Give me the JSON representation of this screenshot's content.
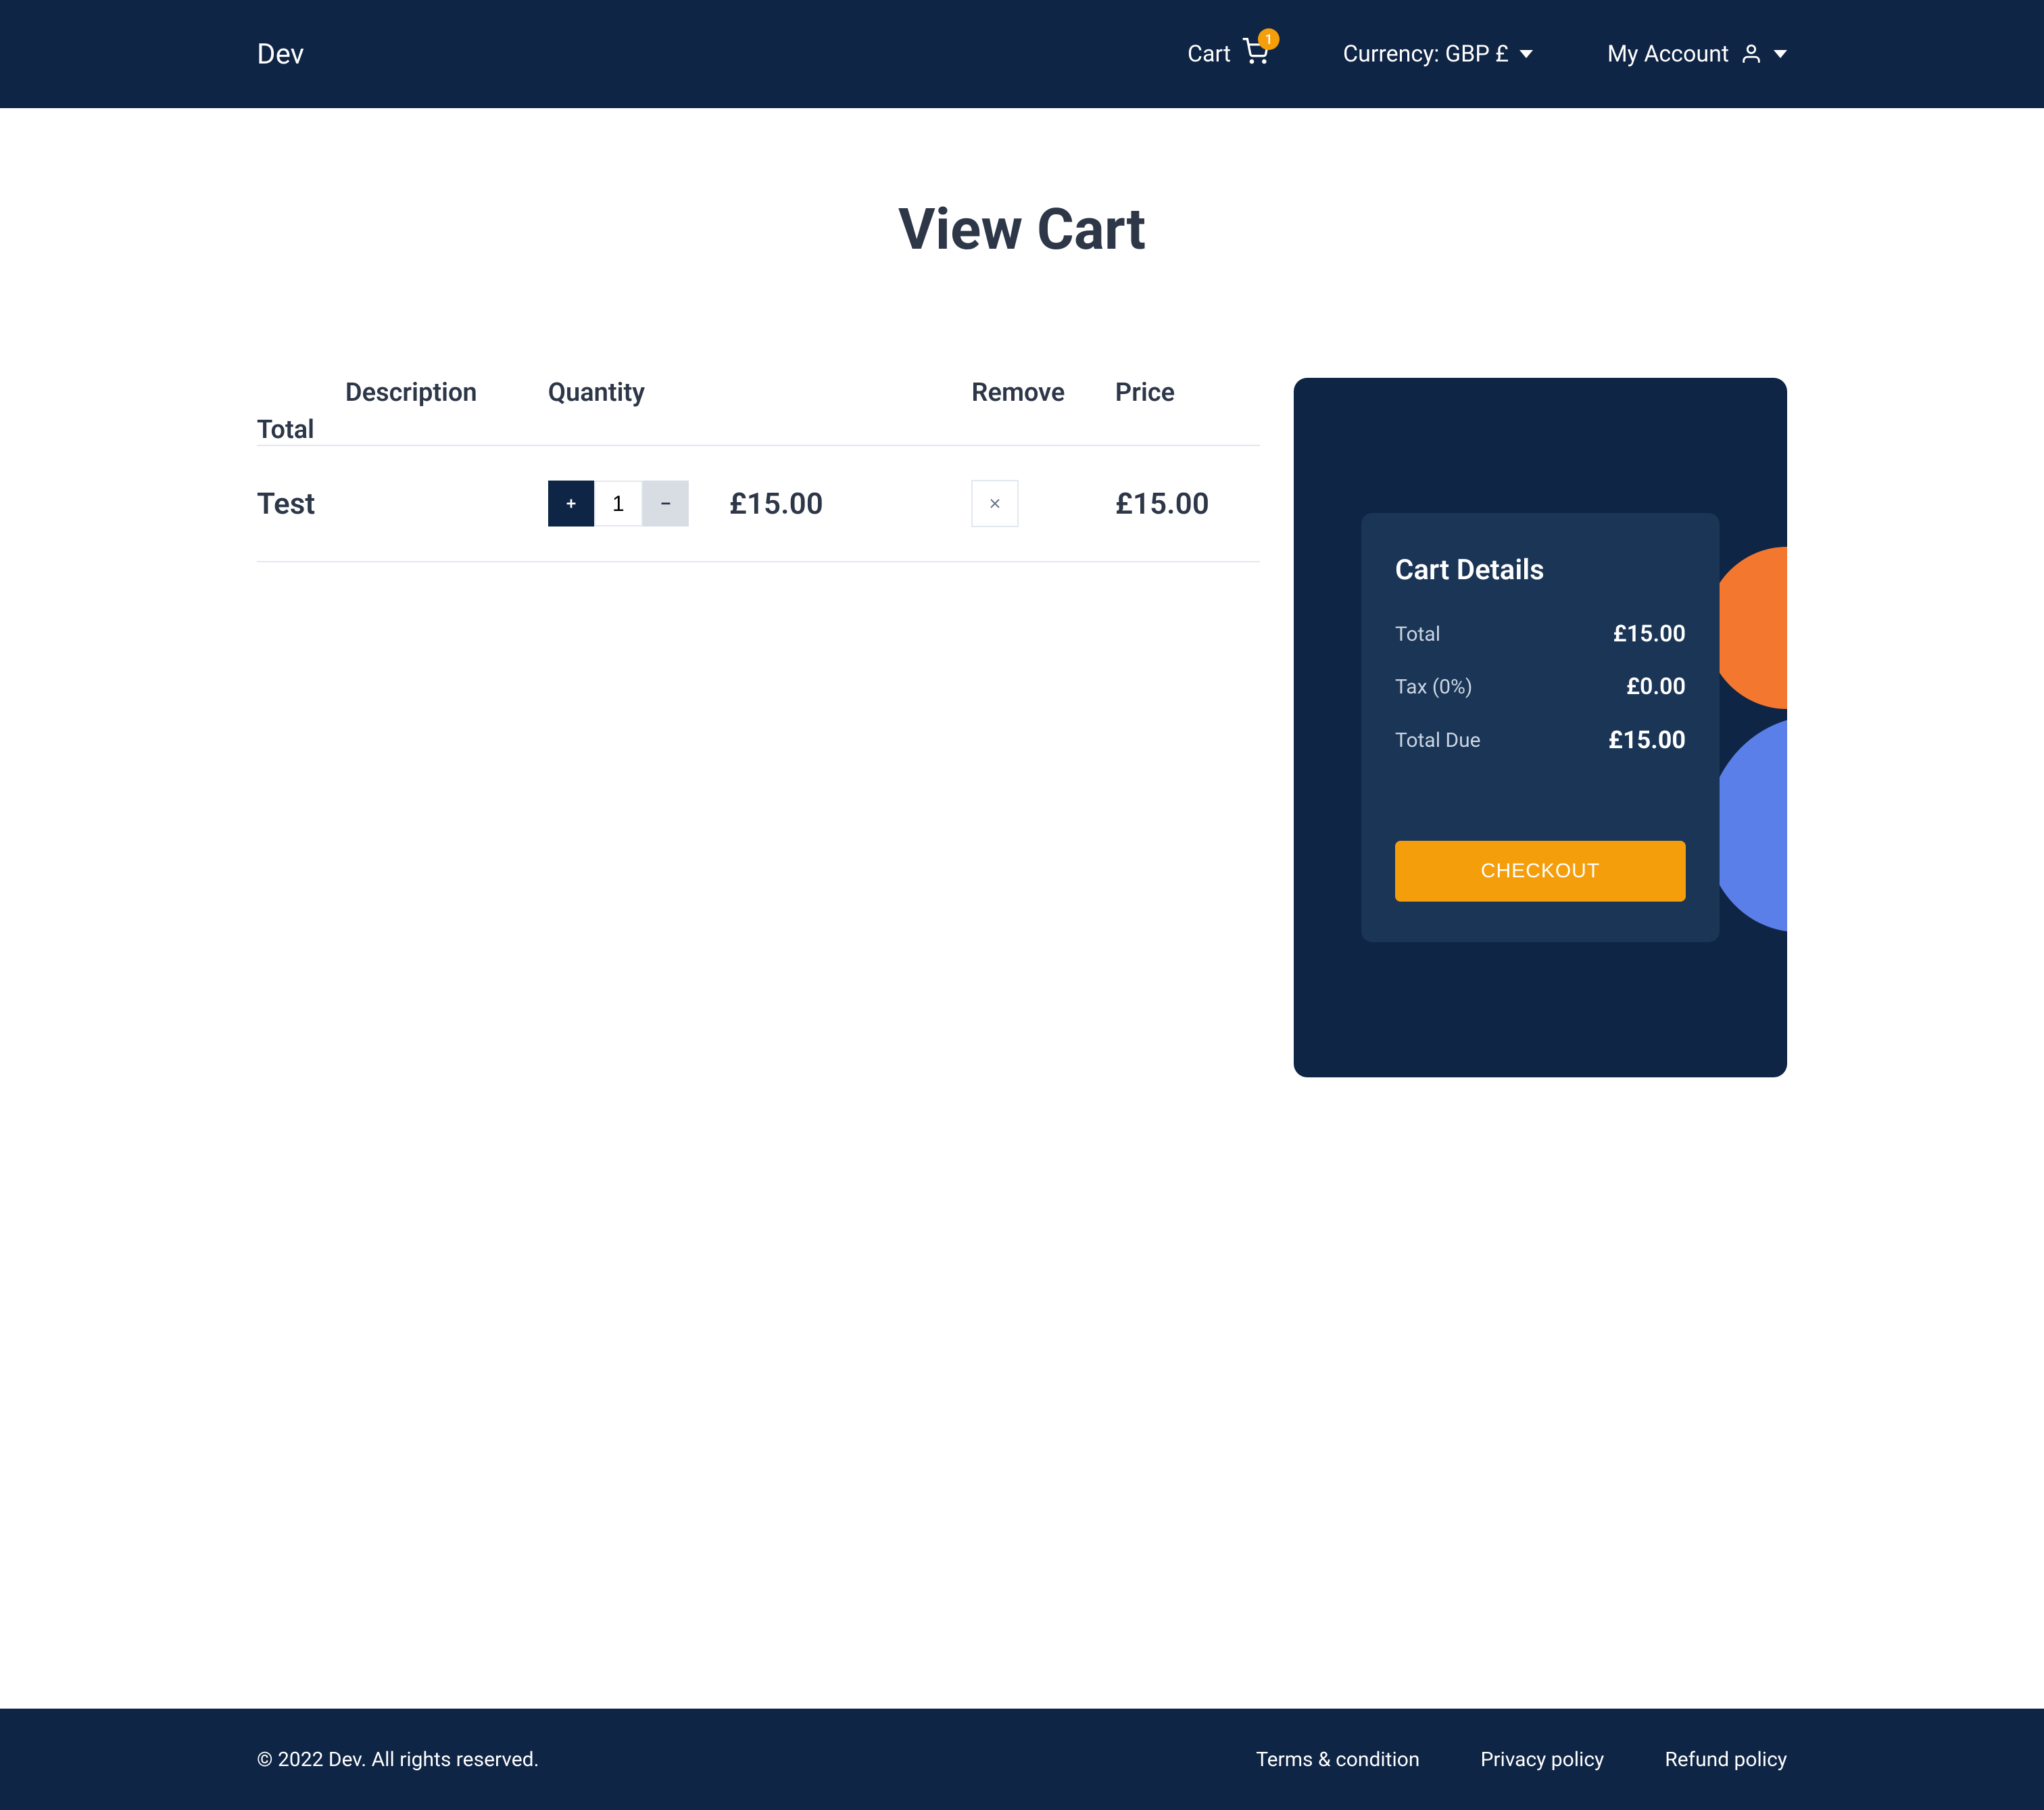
{
  "header": {
    "logo": "Dev",
    "cart_label": "Cart",
    "cart_badge": "1",
    "currency_label": "Currency: GBP £",
    "account_label": "My Account"
  },
  "page": {
    "title": "View Cart"
  },
  "table": {
    "headers": {
      "description": "Description",
      "quantity": "Quantity",
      "remove": "Remove",
      "price": "Price",
      "total": "Total"
    },
    "rows": [
      {
        "description": "Test",
        "quantity": "1",
        "price": "£15.00",
        "total": "£15.00"
      }
    ]
  },
  "details": {
    "title": "Cart Details",
    "total_label": "Total",
    "total_value": "£15.00",
    "tax_label": "Tax (0%)",
    "tax_value": "£0.00",
    "due_label": "Total Due",
    "due_value": "£15.00",
    "checkout": "CHECKOUT"
  },
  "footer": {
    "copyright": "© 2022 Dev. All rights reserved.",
    "links": {
      "terms": "Terms & condition",
      "privacy": "Privacy policy",
      "refund": "Refund policy"
    }
  }
}
